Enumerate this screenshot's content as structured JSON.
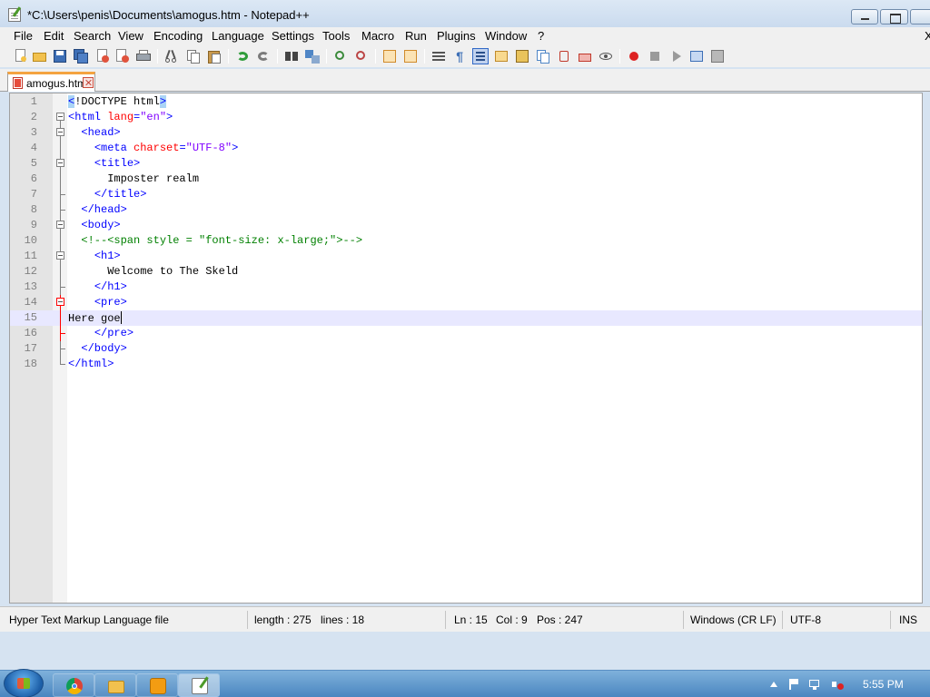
{
  "window": {
    "title": "*C:\\Users\\penis\\Documents\\amogus.htm - Notepad++"
  },
  "menu": {
    "items": [
      "File",
      "Edit",
      "Search",
      "View",
      "Encoding",
      "Language",
      "Settings",
      "Tools",
      "Macro",
      "Run",
      "Plugins",
      "Window",
      "?"
    ],
    "close_glyph": "X"
  },
  "tabs": [
    {
      "label": "amogus.htm",
      "modified": true,
      "active": true
    }
  ],
  "editor": {
    "current_line": 15,
    "lines": [
      {
        "n": "1",
        "text": "<!DOCTYPE html>"
      },
      {
        "n": "2",
        "text": "<html lang=\"en\">"
      },
      {
        "n": "3",
        "text": "  <head>"
      },
      {
        "n": "4",
        "text": "    <meta charset=\"UTF-8\">"
      },
      {
        "n": "5",
        "text": "    <title>"
      },
      {
        "n": "6",
        "text": "      Imposter realm"
      },
      {
        "n": "7",
        "text": "    </title>"
      },
      {
        "n": "8",
        "text": "  </head>"
      },
      {
        "n": "9",
        "text": "  <body>"
      },
      {
        "n": "10",
        "text": "  <!--<span style = \"font-size: x-large;\">-->"
      },
      {
        "n": "11",
        "text": "    <h1>"
      },
      {
        "n": "12",
        "text": "      Welcome to The Skeld"
      },
      {
        "n": "13",
        "text": "    </h1>"
      },
      {
        "n": "14",
        "text": "    <pre>"
      },
      {
        "n": "15",
        "text": "Here goe"
      },
      {
        "n": "16",
        "text": "    </pre>"
      },
      {
        "n": "17",
        "text": "  </body>"
      },
      {
        "n": "18",
        "text": "</html>"
      }
    ]
  },
  "status": {
    "file_type": "Hyper Text Markup Language file",
    "length": "length : 275",
    "lines": "lines : 18",
    "ln": "Ln : 15",
    "col": "Col : 9",
    "pos": "Pos : 247",
    "eol": "Windows (CR LF)",
    "encoding": "UTF-8",
    "mode": "INS"
  },
  "taskbar": {
    "time": "5:55 PM",
    "apps": [
      "chrome",
      "explorer",
      "media-player",
      "notepad++"
    ]
  },
  "colors": {
    "tag": "#0000ff",
    "attribute": "#ff0000",
    "value": "#8000ff",
    "comment": "#008000",
    "current_line": "#e8e8ff",
    "tab_accent": "#f4a340"
  }
}
